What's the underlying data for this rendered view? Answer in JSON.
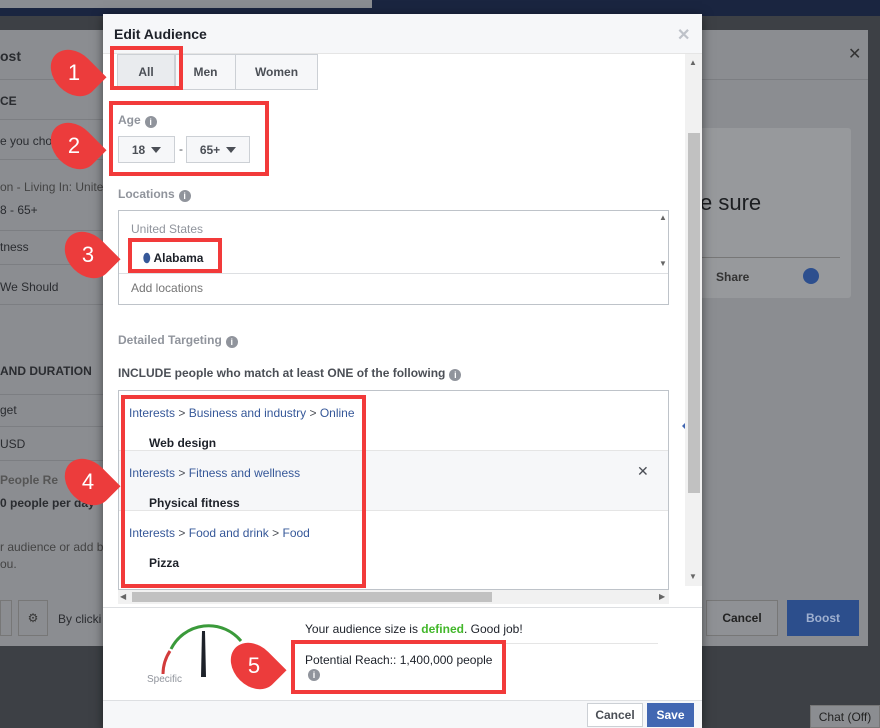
{
  "background": {
    "dialog_title_fragment": "ost",
    "section_audience_fragment": "CE",
    "audience_desc_fragment": "e you cho",
    "location_fragment": "on - Living In: Unite",
    "age_fragment": "8 - 65+",
    "interest_fragment": "tness",
    "we_should_fragment": "We Should",
    "budget_section": "AND DURATION",
    "budget_label_fragment": "get",
    "currency_fragment": "USD",
    "people_reached_fragment": "People Re",
    "people_per_day_fragment": "0 people per day",
    "audience_hint_fragment_1": "r audience or add b",
    "audience_hint_fragment_2": "ou.",
    "terms_fragment": "By clicki",
    "card_text_fragment": "e sure",
    "share_label": "Share",
    "cancel_label": "Cancel",
    "boost_label": "Boost",
    "chat_label": "Chat (Off)"
  },
  "modal": {
    "title": "Edit Audience",
    "gender_tabs": [
      {
        "label": "All",
        "selected": true
      },
      {
        "label": "Men"
      },
      {
        "label": "Women"
      }
    ],
    "age_label": "Age",
    "age_min": "18",
    "age_separator": "-",
    "age_max": "65+",
    "locations_label": "Locations",
    "location_country": "United States",
    "location_selected": "Alabama",
    "add_locations_placeholder": "Add locations",
    "detailed_targeting_label": "Detailed Targeting",
    "include_label": "INCLUDE people who match at least ONE of the following",
    "targeting": [
      {
        "path": [
          "Interests",
          "Business and industry",
          "Online"
        ],
        "item": "Web design"
      },
      {
        "path": [
          "Interests",
          "Fitness and wellness"
        ],
        "item": "Physical fitness"
      },
      {
        "path": [
          "Interests",
          "Food and drink",
          "Food"
        ],
        "item": "Pizza"
      }
    ],
    "path_separator": ">",
    "audience_msg_prefix": "Your audience size is ",
    "audience_msg_status": "defined",
    "audience_msg_suffix": ". Good job!",
    "gauge_label": "Specific",
    "potential_reach": "Potential Reach:: 1,400,000 people",
    "cancel_label": "Cancel",
    "save_label": "Save"
  },
  "annotations": [
    "1",
    "2",
    "3",
    "4",
    "5"
  ],
  "colors": {
    "accent": "#4267b2",
    "highlight": "#f23a3a",
    "defined": "#42b72a",
    "link": "#365899"
  }
}
